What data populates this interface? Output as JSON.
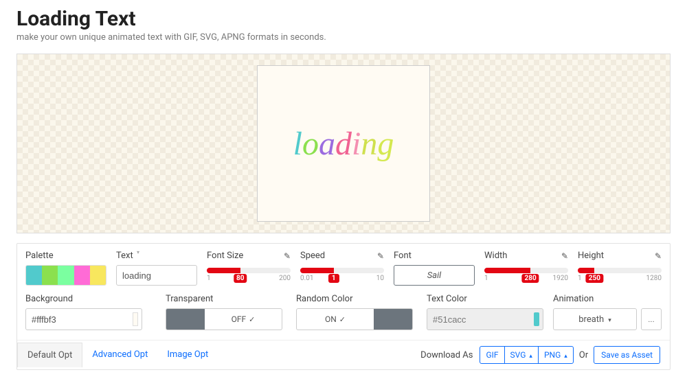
{
  "header": {
    "title": "Loading Text",
    "subtitle": "make your own unique animated text with GIF, SVG, APNG formats in seconds."
  },
  "preview": {
    "letters": [
      "l",
      "o",
      "a",
      "d",
      "i",
      "n",
      "g"
    ]
  },
  "controls": {
    "palette": {
      "label": "Palette",
      "colors": [
        "#51cacc",
        "#8be04e",
        "#7bffa0",
        "#ff6bd6",
        "#f8e75e"
      ]
    },
    "text": {
      "label": "Text",
      "value": "loading"
    },
    "font_size": {
      "label": "Font Size",
      "value": 80,
      "min": 1,
      "max": 200,
      "pct": 40
    },
    "speed": {
      "label": "Speed",
      "value": 1,
      "min": 0.01,
      "max": 10,
      "pct": 40
    },
    "font": {
      "label": "Font",
      "value": "Sail"
    },
    "width": {
      "label": "Width",
      "value": 280,
      "min": 1,
      "max": 1920,
      "pct": 55
    },
    "height": {
      "label": "Height",
      "value": 250,
      "min": 1,
      "max": 1280,
      "pct": 20
    },
    "background": {
      "label": "Background",
      "value": "#fffbf3"
    },
    "transparent": {
      "label": "Transparent",
      "state": "OFF"
    },
    "random_color": {
      "label": "Random Color",
      "state": "ON"
    },
    "text_color": {
      "label": "Text Color",
      "value": "#51cacc"
    },
    "animation": {
      "label": "Animation",
      "value": "breath",
      "more": "..."
    }
  },
  "tabs": {
    "items": [
      "Default Opt",
      "Advanced Opt",
      "Image Opt"
    ],
    "active": 0
  },
  "download": {
    "label": "Download As",
    "buttons": [
      "GIF",
      "SVG",
      "PNG"
    ],
    "or": "Or",
    "save": "Save as Asset"
  }
}
